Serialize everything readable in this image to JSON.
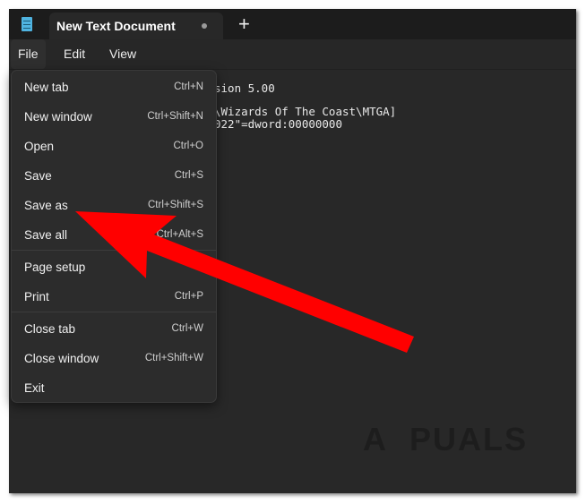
{
  "tab": {
    "title": "New Text Document"
  },
  "menubar": [
    "File",
    "Edit",
    "View"
  ],
  "editor": {
    "lines": [
      "sion 5.00",
      "\\Wizards Of The Coast\\MTGA]",
      "022\"=dword:00000000"
    ]
  },
  "file_menu": [
    {
      "label": "New tab",
      "shortcut": "Ctrl+N"
    },
    {
      "label": "New window",
      "shortcut": "Ctrl+Shift+N"
    },
    {
      "label": "Open",
      "shortcut": "Ctrl+O"
    },
    {
      "label": "Save",
      "shortcut": "Ctrl+S"
    },
    {
      "label": "Save as",
      "shortcut": "Ctrl+Shift+S"
    },
    {
      "label": "Save all",
      "shortcut": "Ctrl+Alt+S"
    },
    {
      "label": "Page setup",
      "shortcut": ""
    },
    {
      "label": "Print",
      "shortcut": "Ctrl+P"
    },
    {
      "label": "Close tab",
      "shortcut": "Ctrl+W"
    },
    {
      "label": "Close window",
      "shortcut": "Ctrl+Shift+W"
    },
    {
      "label": "Exit",
      "shortcut": ""
    }
  ],
  "watermark": "APPUALS",
  "colors": {
    "arrow": "#ff0000"
  }
}
